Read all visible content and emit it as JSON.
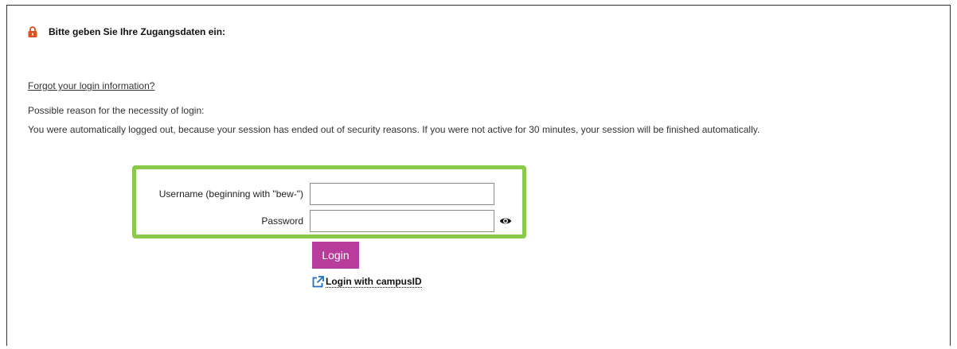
{
  "header": {
    "title": "Bitte geben Sie Ihre Zugangsdaten ein:",
    "icon": "lock-icon"
  },
  "links": {
    "forgot": "Forgot your login information?"
  },
  "info": {
    "reason_title": "Possible reason for the necessity of login:",
    "reason_text": "You were automatically logged out, because your session has ended out of security reasons. If you were not active for 30 minutes, your session will be finished automatically."
  },
  "form": {
    "username_label": "Username (beginning with \"bew-\")",
    "username_value": "",
    "password_label": "Password",
    "password_value": "",
    "show_password_icon": "eye-icon",
    "highlight_color": "#8ac94a"
  },
  "actions": {
    "login_label": "Login",
    "login_color": "#b83c9c",
    "campus_label": "Login with campusID",
    "campus_icon": "external-link-icon"
  }
}
